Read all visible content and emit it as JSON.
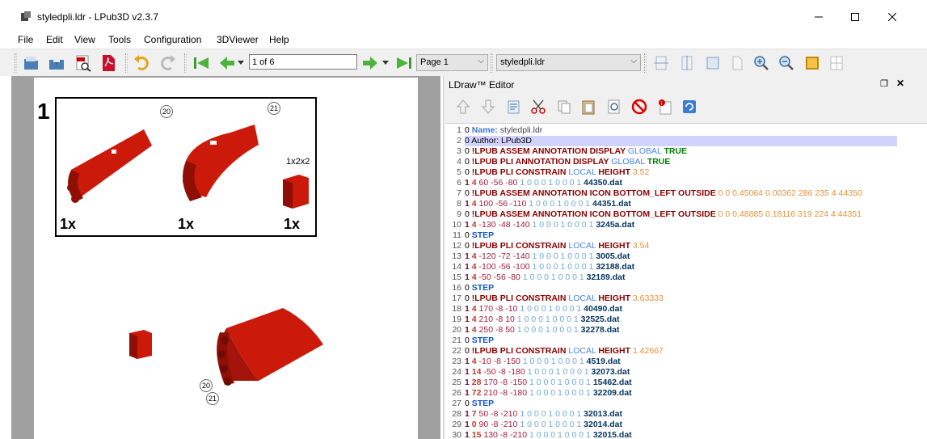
{
  "window": {
    "title": "styledpli.ldr - LPub3D v2.3.7"
  },
  "menu": [
    "File",
    "Edit",
    "View",
    "Tools",
    "Configuration",
    "3DViewer",
    "Help"
  ],
  "toolbar": {
    "page_nav_value": "1 of 6",
    "page_combo": "Page 1",
    "file_combo": "styledpli.ldr"
  },
  "page": {
    "step_number": "1",
    "pli": {
      "part_size_label": "1x2x2",
      "quantities": [
        "1x",
        "1x",
        "1x"
      ],
      "annotations": [
        "20",
        "21"
      ]
    },
    "assembly_annotations": [
      "20",
      "21"
    ]
  },
  "editor": {
    "title": "LDraw™ Editor",
    "lines": [
      {
        "n": "1",
        "t": [
          [
            "c-zero",
            "0 "
          ],
          [
            "c-nm",
            "Name: "
          ],
          [
            "c-gray",
            "styledpli.ldr"
          ]
        ]
      },
      {
        "n": "2",
        "t": [
          [
            "c-zero",
            "0 "
          ],
          [
            "c-zero",
            "Author: "
          ],
          [
            "c-zero",
            "LPub3D"
          ]
        ],
        "hl": true
      },
      {
        "n": "3",
        "t": [
          [
            "c-zero",
            "0 "
          ],
          [
            "c-meta",
            "!LPUB ASSEM ANNOTATION DISPLAY "
          ],
          [
            "c-kw",
            "GLOBAL "
          ],
          [
            "c-true",
            "TRUE"
          ]
        ]
      },
      {
        "n": "4",
        "t": [
          [
            "c-zero",
            "0 "
          ],
          [
            "c-meta",
            "!LPUB PLI ANNOTATION DISPLAY "
          ],
          [
            "c-kw",
            "GLOBAL "
          ],
          [
            "c-true",
            "TRUE"
          ]
        ]
      },
      {
        "n": "5",
        "t": [
          [
            "c-zero",
            "0 "
          ],
          [
            "c-meta",
            "!LPUB PLI CONSTRAIN "
          ],
          [
            "c-kw",
            "LOCAL "
          ],
          [
            "c-meta",
            "HEIGHT "
          ],
          [
            "c-num",
            "3.52"
          ]
        ]
      },
      {
        "n": "6",
        "t": [
          [
            "c-one",
            "1 "
          ],
          [
            "c-col",
            "4 "
          ],
          [
            "c-pos",
            "60 -56 -80 "
          ],
          [
            "c-mat",
            "1 0 0 0 1 0 0 0 1 "
          ],
          [
            "c-file",
            "44350.dat"
          ]
        ]
      },
      {
        "n": "7",
        "t": [
          [
            "c-zero",
            "0 "
          ],
          [
            "c-meta",
            "!LPUB ASSEM ANNOTATION ICON BOTTOM_LEFT OUTSIDE "
          ],
          [
            "c-num",
            "0 0 0.45064 0.00362 286 235 4 44350"
          ]
        ]
      },
      {
        "n": "8",
        "t": [
          [
            "c-one",
            "1 "
          ],
          [
            "c-col",
            "4 "
          ],
          [
            "c-pos",
            "100 -56 -110 "
          ],
          [
            "c-mat",
            "1 0 0 0 1 0 0 0 1 "
          ],
          [
            "c-file",
            "44351.dat"
          ]
        ]
      },
      {
        "n": "9",
        "t": [
          [
            "c-zero",
            "0 "
          ],
          [
            "c-meta",
            "!LPUB ASSEM ANNOTATION ICON BOTTOM_LEFT OUTSIDE "
          ],
          [
            "c-num",
            "0 0 0.48885 0.18116 319 224 4 44351"
          ]
        ]
      },
      {
        "n": "10",
        "t": [
          [
            "c-one",
            "1 "
          ],
          [
            "c-col",
            "4 "
          ],
          [
            "c-pos",
            "-130 -48 -140 "
          ],
          [
            "c-mat",
            "1 0 0 0 1 0 0 0 1 "
          ],
          [
            "c-file",
            "3245a.dat"
          ]
        ]
      },
      {
        "n": "11",
        "t": [
          [
            "c-zero",
            "0 "
          ],
          [
            "c-step",
            "STEP"
          ]
        ]
      },
      {
        "n": "12",
        "t": [
          [
            "c-zero",
            "0 "
          ],
          [
            "c-meta",
            "!LPUB PLI CONSTRAIN "
          ],
          [
            "c-kw",
            "LOCAL "
          ],
          [
            "c-meta",
            "HEIGHT "
          ],
          [
            "c-num",
            "3.54"
          ]
        ]
      },
      {
        "n": "13",
        "t": [
          [
            "c-one",
            "1 "
          ],
          [
            "c-col",
            "4 "
          ],
          [
            "c-pos",
            "-120 -72 -140 "
          ],
          [
            "c-mat",
            "1 0 0 0 1 0 0 0 1 "
          ],
          [
            "c-file",
            "3005.dat"
          ]
        ]
      },
      {
        "n": "14",
        "t": [
          [
            "c-one",
            "1 "
          ],
          [
            "c-col",
            "4 "
          ],
          [
            "c-pos",
            "-100 -56 -100 "
          ],
          [
            "c-mat",
            "1 0 0 0 1 0 0 0 1 "
          ],
          [
            "c-file",
            "32188.dat"
          ]
        ]
      },
      {
        "n": "15",
        "t": [
          [
            "c-one",
            "1 "
          ],
          [
            "c-col",
            "4 "
          ],
          [
            "c-pos",
            "-50 -56 -80 "
          ],
          [
            "c-mat",
            "1 0 0 0 1 0 0 0 1 "
          ],
          [
            "c-file",
            "32189.dat"
          ]
        ]
      },
      {
        "n": "16",
        "t": [
          [
            "c-zero",
            "0 "
          ],
          [
            "c-step",
            "STEP"
          ]
        ]
      },
      {
        "n": "17",
        "t": [
          [
            "c-zero",
            "0 "
          ],
          [
            "c-meta",
            "!LPUB PLI CONSTRAIN "
          ],
          [
            "c-kw",
            "LOCAL "
          ],
          [
            "c-meta",
            "HEIGHT "
          ],
          [
            "c-num",
            "3.63333"
          ]
        ]
      },
      {
        "n": "18",
        "t": [
          [
            "c-one",
            "1 "
          ],
          [
            "c-col",
            "4 "
          ],
          [
            "c-pos",
            "170 -8 -10 "
          ],
          [
            "c-mat",
            "1 0 0 0 1 0 0 0 1 "
          ],
          [
            "c-file",
            "40490.dat"
          ]
        ]
      },
      {
        "n": "19",
        "t": [
          [
            "c-one",
            "1 "
          ],
          [
            "c-col",
            "4 "
          ],
          [
            "c-pos",
            "210 -8 10 "
          ],
          [
            "c-mat",
            "1 0 0 0 1 0 0 0 1 "
          ],
          [
            "c-file",
            "32525.dat"
          ]
        ]
      },
      {
        "n": "20",
        "t": [
          [
            "c-one",
            "1 "
          ],
          [
            "c-col",
            "4 "
          ],
          [
            "c-pos",
            "250 -8 50 "
          ],
          [
            "c-mat",
            "1 0 0 0 1 0 0 0 1 "
          ],
          [
            "c-file",
            "32278.dat"
          ]
        ]
      },
      {
        "n": "21",
        "t": [
          [
            "c-zero",
            "0 "
          ],
          [
            "c-step",
            "STEP"
          ]
        ]
      },
      {
        "n": "22",
        "t": [
          [
            "c-zero",
            "0 "
          ],
          [
            "c-meta",
            "!LPUB PLI CONSTRAIN "
          ],
          [
            "c-kw",
            "LOCAL "
          ],
          [
            "c-meta",
            "HEIGHT "
          ],
          [
            "c-num",
            "1.42667"
          ]
        ]
      },
      {
        "n": "23",
        "t": [
          [
            "c-one",
            "1 "
          ],
          [
            "c-col",
            "4 "
          ],
          [
            "c-pos",
            "-10 -8 -150 "
          ],
          [
            "c-mat",
            "1 0 0 0 1 0 0 0 1 "
          ],
          [
            "c-file",
            "4519.dat"
          ]
        ]
      },
      {
        "n": "24",
        "t": [
          [
            "c-one",
            "1 "
          ],
          [
            "c-col",
            "14 "
          ],
          [
            "c-pos",
            "-50 -8 -180 "
          ],
          [
            "c-mat",
            "1 0 0 0 1 0 0 0 1 "
          ],
          [
            "c-file",
            "32073.dat"
          ]
        ]
      },
      {
        "n": "25",
        "t": [
          [
            "c-one",
            "1 "
          ],
          [
            "c-col",
            "28 "
          ],
          [
            "c-pos",
            "170 -8 -150 "
          ],
          [
            "c-mat",
            "1 0 0 0 1 0 0 0 1 "
          ],
          [
            "c-file",
            "15462.dat"
          ]
        ]
      },
      {
        "n": "26",
        "t": [
          [
            "c-one",
            "1 "
          ],
          [
            "c-col",
            "72 "
          ],
          [
            "c-pos",
            "210 -8 -180 "
          ],
          [
            "c-mat",
            "1 0 0 0 1 0 0 0 1 "
          ],
          [
            "c-file",
            "32209.dat"
          ]
        ]
      },
      {
        "n": "27",
        "t": [
          [
            "c-zero",
            "0 "
          ],
          [
            "c-step",
            "STEP"
          ]
        ]
      },
      {
        "n": "28",
        "t": [
          [
            "c-one",
            "1 "
          ],
          [
            "c-col",
            "7 "
          ],
          [
            "c-pos",
            "50 -8 -210 "
          ],
          [
            "c-mat",
            "1 0 0 0 1 0 0 0 1 "
          ],
          [
            "c-file",
            "32013.dat"
          ]
        ]
      },
      {
        "n": "29",
        "t": [
          [
            "c-one",
            "1 "
          ],
          [
            "c-col",
            "0 "
          ],
          [
            "c-pos",
            "90 -8 -210 "
          ],
          [
            "c-mat",
            "1 0 0 0 1 0 0 0 1 "
          ],
          [
            "c-file",
            "32014.dat"
          ]
        ]
      },
      {
        "n": "30",
        "t": [
          [
            "c-one",
            "1 "
          ],
          [
            "c-col",
            "15 "
          ],
          [
            "c-pos",
            "130 -8 -210 "
          ],
          [
            "c-mat",
            "1 0 0 0 1 0 0 0 1 "
          ],
          [
            "c-file",
            "32015.dat"
          ]
        ]
      }
    ]
  },
  "colors": {
    "part_red": "#cc1a0a",
    "toolbar_bg": "#f0f0f0",
    "highlight_line": "#d2d2ff"
  }
}
